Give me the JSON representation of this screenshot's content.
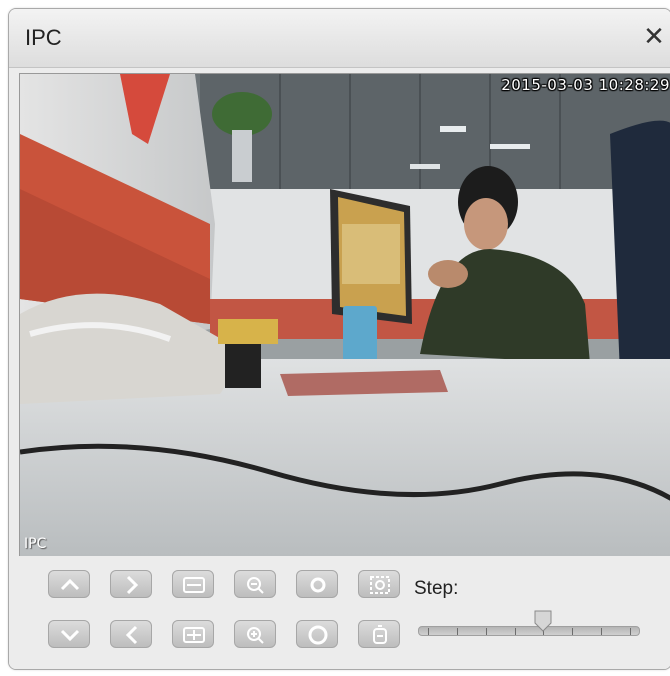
{
  "window": {
    "title": "IPC",
    "close_glyph": "✕"
  },
  "video": {
    "timestamp": "2015-03-03 10:28:29",
    "channel_label": "IPC"
  },
  "ptz": {
    "buttons": [
      {
        "name": "pan-up-button",
        "icon": "chevron-up-icon"
      },
      {
        "name": "pan-right-button",
        "icon": "chevron-right-icon"
      },
      {
        "name": "focus-far-button",
        "icon": "focus-expand-icon"
      },
      {
        "name": "zoom-out-button",
        "icon": "zoom-out-icon"
      },
      {
        "name": "iris-close-button",
        "icon": "iris-small-icon"
      },
      {
        "name": "auto-focus-button",
        "icon": "auto-focus-icon"
      },
      {
        "name": "pan-down-button",
        "icon": "chevron-down-icon"
      },
      {
        "name": "pan-left-button",
        "icon": "chevron-left-icon"
      },
      {
        "name": "focus-near-button",
        "icon": "focus-contract-icon"
      },
      {
        "name": "zoom-in-button",
        "icon": "zoom-in-icon"
      },
      {
        "name": "iris-open-button",
        "icon": "iris-large-icon"
      },
      {
        "name": "reset-button",
        "icon": "lens-reset-icon"
      }
    ],
    "step_label": "Step:",
    "step": {
      "value": 5,
      "min": 1,
      "max": 8
    }
  },
  "colors": {
    "button_icon": "#ffffff",
    "button_face": "#c8c8c8"
  }
}
